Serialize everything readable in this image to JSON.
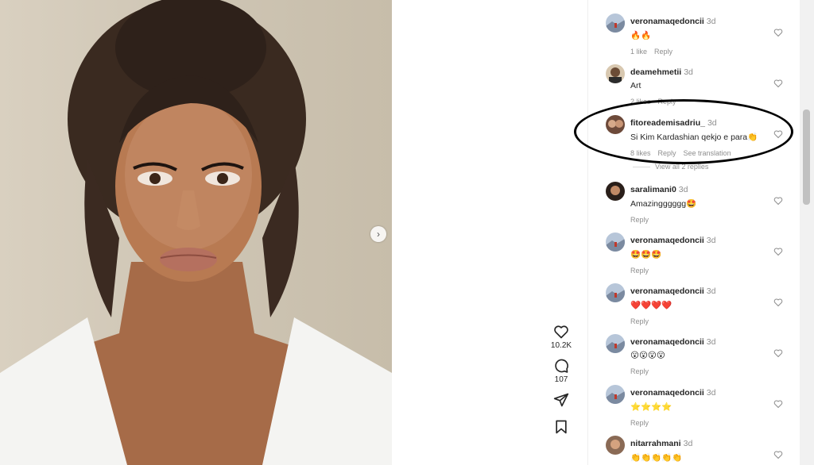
{
  "actions": {
    "likes_count": "10.2K",
    "comments_count": "107"
  },
  "view_replies": "View all 2 replies",
  "comments": [
    {
      "user": "veronamaqedoncii",
      "time": "3d",
      "text": "🔥🔥",
      "meta": [
        "1 like",
        "Reply"
      ]
    },
    {
      "user": "deamehmetii",
      "time": "3d",
      "text": "Art",
      "meta": [
        "2 likes",
        "Reply"
      ]
    },
    {
      "user": "fitoreademisadriu_",
      "time": "3d",
      "text": "Si Kim Kardashian qekjo e para👏",
      "meta": [
        "8 likes",
        "Reply",
        "See translation"
      ]
    },
    {
      "user": "saralimani0",
      "time": "3d",
      "text": "Amazingggggg🤩",
      "meta": [
        "Reply"
      ]
    },
    {
      "user": "veronamaqedoncii",
      "time": "3d",
      "text": "🤩🤩🤩",
      "meta": [
        "Reply"
      ]
    },
    {
      "user": "veronamaqedoncii",
      "time": "3d",
      "text": "❤️❤️❤️❤️",
      "meta": [
        "Reply"
      ]
    },
    {
      "user": "veronamaqedoncii",
      "time": "3d",
      "text": "😮😮😮😮",
      "meta": [
        "Reply"
      ]
    },
    {
      "user": "veronamaqedoncii",
      "time": "3d",
      "text": "⭐⭐⭐⭐",
      "meta": [
        "Reply"
      ]
    },
    {
      "user": "nitarrahmani",
      "time": "3d",
      "text": "👏👏👏👏👏",
      "meta": [
        "Reply"
      ]
    }
  ],
  "colors": {
    "text": "#262626",
    "muted": "#8e8e8e",
    "border": "#efefef"
  }
}
